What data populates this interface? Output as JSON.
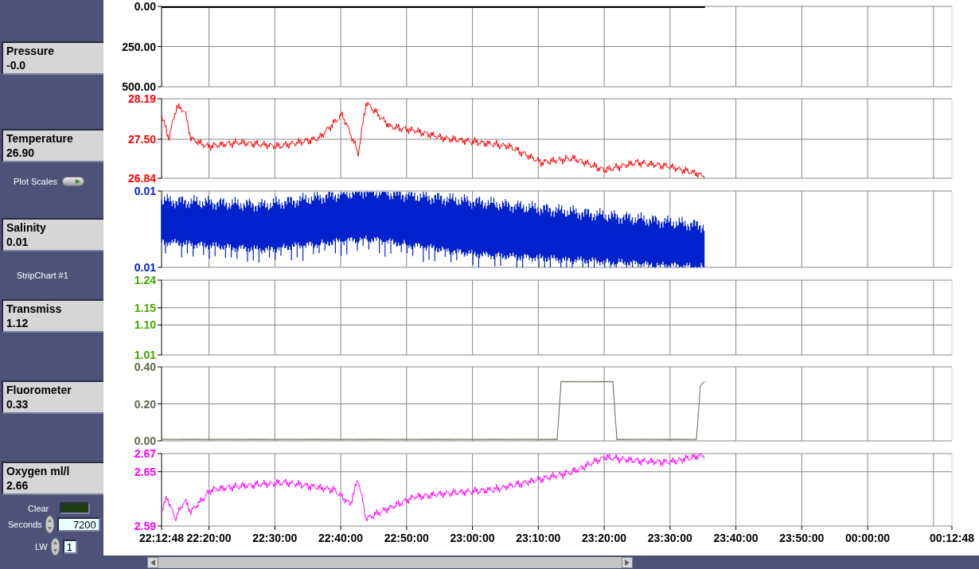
{
  "indicators": [
    {
      "label": "Pressure",
      "value": "-0.0"
    },
    {
      "label": "Temperature",
      "value": "26.90"
    },
    {
      "label": "Salinity",
      "value": "0.01"
    },
    {
      "label": "Transmiss",
      "value": "1.12"
    },
    {
      "label": "Fluorometer",
      "value": "0.33"
    },
    {
      "label": "Oxygen ml/l",
      "value": "2.66"
    }
  ],
  "plot_scales": {
    "label": "Plot Scales",
    "on": true
  },
  "strip_chart_label": "StripChart #1",
  "clear": {
    "label": "Clear"
  },
  "seconds": {
    "label": "Seconds",
    "value": "7200"
  },
  "lw": {
    "label": "LW",
    "value": "1"
  },
  "strips": [
    {
      "kind": "flat",
      "color": "#000000",
      "axis_labels": [
        "0.00",
        "250.00",
        "500.00"
      ]
    },
    {
      "kind": "noisy",
      "color": "#ff0000",
      "axis_labels": [
        "28.19",
        "27.50",
        "26.84"
      ]
    },
    {
      "kind": "band",
      "color": "#0022cc",
      "axis_labels": [
        "0.01",
        "0.01"
      ]
    },
    {
      "kind": "empty",
      "color": "#44aa00",
      "axis_labels": [
        "1.24",
        "1.15",
        "1.10",
        "1.01"
      ]
    },
    {
      "kind": "step",
      "color": "#5a6b4a",
      "axis_labels": [
        "0.40",
        "0.20",
        "0.00"
      ]
    },
    {
      "kind": "noisy",
      "color": "#ff00ff",
      "axis_labels": [
        "2.67",
        "2.65",
        "2.59"
      ]
    }
  ],
  "time_labels": [
    "22:12:48",
    "22:20:00",
    "22:30:00",
    "22:40:00",
    "22:50:00",
    "23:00:00",
    "23:10:00",
    "23:20:00",
    "23:30:00",
    "23:40:00",
    "23:50:00",
    "00:00:00",
    "00:12:48"
  ]
}
